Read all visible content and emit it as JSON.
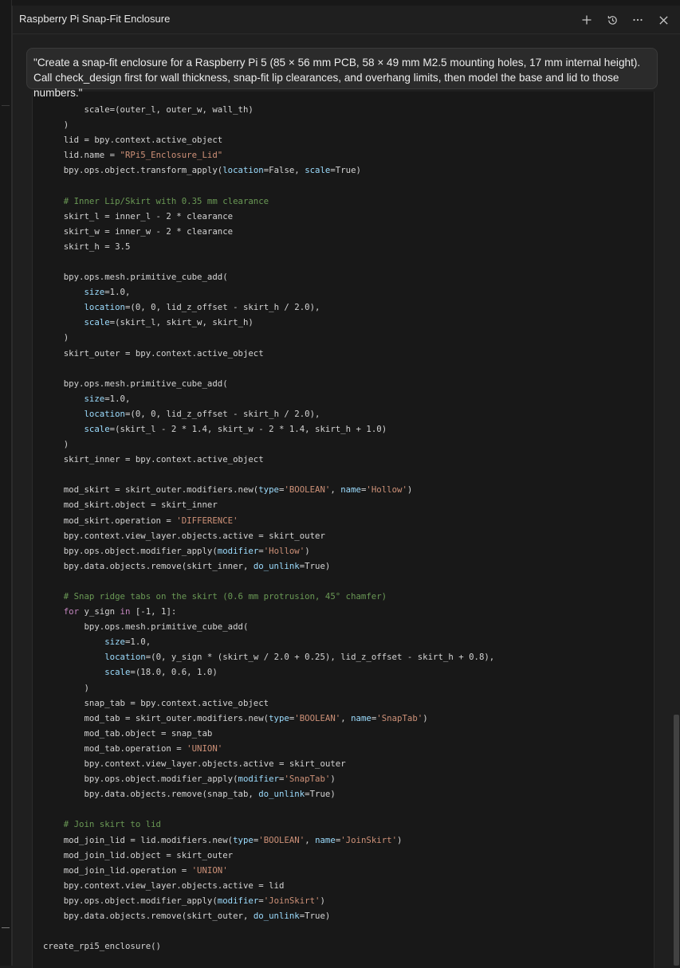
{
  "window": {
    "title": "Raspberry Pi Snap-Fit Enclosure"
  },
  "header_icons": [
    "plus-icon",
    "history-icon",
    "more-icon",
    "close-icon"
  ],
  "prompt": {
    "text": "\"Create a snap-fit enclosure for a Raspberry Pi 5 (85 × 56 mm PCB, 58 × 49 mm M2.5 mounting holes, 17 mm internal height). Call check_design first for wall thickness, snap-fit lip clearances, and overhang limits, then model the base and lid to those numbers.\""
  },
  "colors": {
    "keyword": "#c586c0",
    "string": "#ce9178",
    "param": "#9cdcfe",
    "comment": "#6a9955",
    "default": "#d4d4d4"
  },
  "code_lines": [
    [
      [
        "        scale=(outer_l, outer_w, wall_th)",
        "default"
      ]
    ],
    [
      [
        "    )",
        "default"
      ]
    ],
    [
      [
        "    lid = bpy.context.active_object",
        "default"
      ]
    ],
    [
      [
        "    lid.name = ",
        "default"
      ],
      [
        "\"RPi5_Enclosure_Lid\"",
        "string"
      ]
    ],
    [
      [
        "    bpy.ops.object.transform_apply(",
        "default"
      ],
      [
        "location",
        "param"
      ],
      [
        "=False, ",
        "default"
      ],
      [
        "scale",
        "param"
      ],
      [
        "=True)",
        "default"
      ]
    ],
    [
      [
        "",
        "default"
      ]
    ],
    [
      [
        "    # Inner Lip/Skirt with 0.35 mm clearance",
        "comment"
      ]
    ],
    [
      [
        "    skirt_l = inner_l - 2 * clearance",
        "default"
      ]
    ],
    [
      [
        "    skirt_w = inner_w - 2 * clearance",
        "default"
      ]
    ],
    [
      [
        "    skirt_h = 3.5",
        "default"
      ]
    ],
    [
      [
        "",
        "default"
      ]
    ],
    [
      [
        "    bpy.ops.mesh.primitive_cube_add(",
        "default"
      ]
    ],
    [
      [
        "        ",
        "default"
      ],
      [
        "size",
        "param"
      ],
      [
        "=1.0,",
        "default"
      ]
    ],
    [
      [
        "        ",
        "default"
      ],
      [
        "location",
        "param"
      ],
      [
        "=(0, 0, lid_z_offset - skirt_h / 2.0),",
        "default"
      ]
    ],
    [
      [
        "        ",
        "default"
      ],
      [
        "scale",
        "param"
      ],
      [
        "=(skirt_l, skirt_w, skirt_h)",
        "default"
      ]
    ],
    [
      [
        "    )",
        "default"
      ]
    ],
    [
      [
        "    skirt_outer = bpy.context.active_object",
        "default"
      ]
    ],
    [
      [
        "",
        "default"
      ]
    ],
    [
      [
        "    bpy.ops.mesh.primitive_cube_add(",
        "default"
      ]
    ],
    [
      [
        "        ",
        "default"
      ],
      [
        "size",
        "param"
      ],
      [
        "=1.0,",
        "default"
      ]
    ],
    [
      [
        "        ",
        "default"
      ],
      [
        "location",
        "param"
      ],
      [
        "=(0, 0, lid_z_offset - skirt_h / 2.0),",
        "default"
      ]
    ],
    [
      [
        "        ",
        "default"
      ],
      [
        "scale",
        "param"
      ],
      [
        "=(skirt_l - 2 * 1.4, skirt_w - 2 * 1.4, skirt_h + 1.0)",
        "default"
      ]
    ],
    [
      [
        "    )",
        "default"
      ]
    ],
    [
      [
        "    skirt_inner = bpy.context.active_object",
        "default"
      ]
    ],
    [
      [
        "",
        "default"
      ]
    ],
    [
      [
        "    mod_skirt = skirt_outer.modifiers.new(",
        "default"
      ],
      [
        "type",
        "param"
      ],
      [
        "=",
        "default"
      ],
      [
        "'BOOLEAN'",
        "string"
      ],
      [
        ", ",
        "default"
      ],
      [
        "name",
        "param"
      ],
      [
        "=",
        "default"
      ],
      [
        "'Hollow'",
        "string"
      ],
      [
        ")",
        "default"
      ]
    ],
    [
      [
        "    mod_skirt.object = skirt_inner",
        "default"
      ]
    ],
    [
      [
        "    mod_skirt.operation = ",
        "default"
      ],
      [
        "'DIFFERENCE'",
        "string"
      ]
    ],
    [
      [
        "    bpy.context.view_layer.objects.active = skirt_outer",
        "default"
      ]
    ],
    [
      [
        "    bpy.ops.object.modifier_apply(",
        "default"
      ],
      [
        "modifier",
        "param"
      ],
      [
        "=",
        "default"
      ],
      [
        "'Hollow'",
        "string"
      ],
      [
        ")",
        "default"
      ]
    ],
    [
      [
        "    bpy.data.objects.remove(skirt_inner, ",
        "default"
      ],
      [
        "do_unlink",
        "param"
      ],
      [
        "=True)",
        "default"
      ]
    ],
    [
      [
        "",
        "default"
      ]
    ],
    [
      [
        "    # Snap ridge tabs on the skirt (0.6 mm protrusion, 45° chamfer)",
        "comment"
      ]
    ],
    [
      [
        "    ",
        "default"
      ],
      [
        "for",
        "keyword"
      ],
      [
        " y_sign ",
        "default"
      ],
      [
        "in",
        "keyword"
      ],
      [
        " [-1, 1]:",
        "default"
      ]
    ],
    [
      [
        "        bpy.ops.mesh.primitive_cube_add(",
        "default"
      ]
    ],
    [
      [
        "            ",
        "default"
      ],
      [
        "size",
        "param"
      ],
      [
        "=1.0,",
        "default"
      ]
    ],
    [
      [
        "            ",
        "default"
      ],
      [
        "location",
        "param"
      ],
      [
        "=(0, y_sign * (skirt_w / 2.0 + 0.25), lid_z_offset - skirt_h + 0.8),",
        "default"
      ]
    ],
    [
      [
        "            ",
        "default"
      ],
      [
        "scale",
        "param"
      ],
      [
        "=(18.0, 0.6, 1.0)",
        "default"
      ]
    ],
    [
      [
        "        )",
        "default"
      ]
    ],
    [
      [
        "        snap_tab = bpy.context.active_object",
        "default"
      ]
    ],
    [
      [
        "        mod_tab = skirt_outer.modifiers.new(",
        "default"
      ],
      [
        "type",
        "param"
      ],
      [
        "=",
        "default"
      ],
      [
        "'BOOLEAN'",
        "string"
      ],
      [
        ", ",
        "default"
      ],
      [
        "name",
        "param"
      ],
      [
        "=",
        "default"
      ],
      [
        "'SnapTab'",
        "string"
      ],
      [
        ")",
        "default"
      ]
    ],
    [
      [
        "        mod_tab.object = snap_tab",
        "default"
      ]
    ],
    [
      [
        "        mod_tab.operation = ",
        "default"
      ],
      [
        "'UNION'",
        "string"
      ]
    ],
    [
      [
        "        bpy.context.view_layer.objects.active = skirt_outer",
        "default"
      ]
    ],
    [
      [
        "        bpy.ops.object.modifier_apply(",
        "default"
      ],
      [
        "modifier",
        "param"
      ],
      [
        "=",
        "default"
      ],
      [
        "'SnapTab'",
        "string"
      ],
      [
        ")",
        "default"
      ]
    ],
    [
      [
        "        bpy.data.objects.remove(snap_tab, ",
        "default"
      ],
      [
        "do_unlink",
        "param"
      ],
      [
        "=True)",
        "default"
      ]
    ],
    [
      [
        "",
        "default"
      ]
    ],
    [
      [
        "    # Join skirt to lid",
        "comment"
      ]
    ],
    [
      [
        "    mod_join_lid = lid.modifiers.new(",
        "default"
      ],
      [
        "type",
        "param"
      ],
      [
        "=",
        "default"
      ],
      [
        "'BOOLEAN'",
        "string"
      ],
      [
        ", ",
        "default"
      ],
      [
        "name",
        "param"
      ],
      [
        "=",
        "default"
      ],
      [
        "'JoinSkirt'",
        "string"
      ],
      [
        ")",
        "default"
      ]
    ],
    [
      [
        "    mod_join_lid.object = skirt_outer",
        "default"
      ]
    ],
    [
      [
        "    mod_join_lid.operation = ",
        "default"
      ],
      [
        "'UNION'",
        "string"
      ]
    ],
    [
      [
        "    bpy.context.view_layer.objects.active = lid",
        "default"
      ]
    ],
    [
      [
        "    bpy.ops.object.modifier_apply(",
        "default"
      ],
      [
        "modifier",
        "param"
      ],
      [
        "=",
        "default"
      ],
      [
        "'JoinSkirt'",
        "string"
      ],
      [
        ")",
        "default"
      ]
    ],
    [
      [
        "    bpy.data.objects.remove(skirt_outer, ",
        "default"
      ],
      [
        "do_unlink",
        "param"
      ],
      [
        "=True)",
        "default"
      ]
    ],
    [
      [
        "",
        "default"
      ]
    ],
    [
      [
        "create_rpi5_enclosure()",
        "default"
      ]
    ]
  ]
}
